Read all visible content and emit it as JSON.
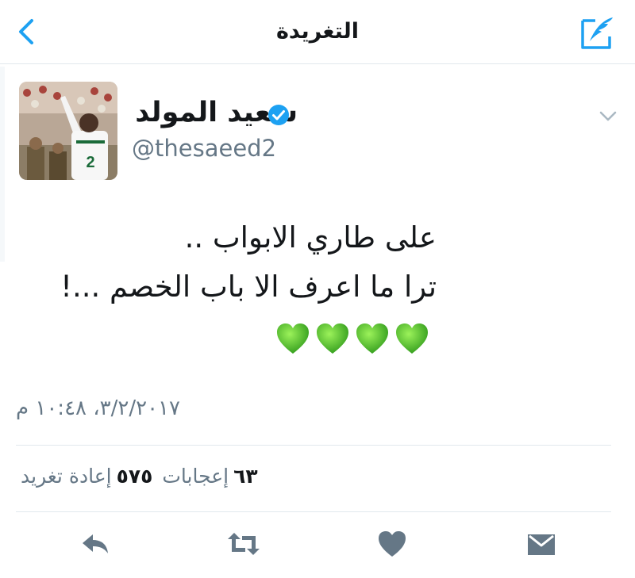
{
  "navbar": {
    "title": "التغريدة",
    "back_icon": "chevron-left-icon",
    "compose_icon": "compose-tweet-icon",
    "accent_color": "#1da1f2"
  },
  "tweet": {
    "author_name": "سعيد المولد",
    "author_handle": "@thesaeed2",
    "verified": true,
    "text_line1": "على طاري الابواب ..",
    "text_line2": "ترا ما اعرف الا باب الخصم ...!",
    "emoji": [
      "green-heart",
      "green-heart",
      "green-heart",
      "green-heart"
    ],
    "timestamp": "٣/٢/٢٠١٧، ١٠:٤٨ م"
  },
  "stats": {
    "retweets_count": "٥٧٥",
    "retweets_label": "إعادة تغريد",
    "likes_count": "٦٣",
    "likes_label": "إعجابات"
  },
  "actions": [
    "reply-icon",
    "retweet-icon",
    "like-icon",
    "direct-message-icon"
  ]
}
